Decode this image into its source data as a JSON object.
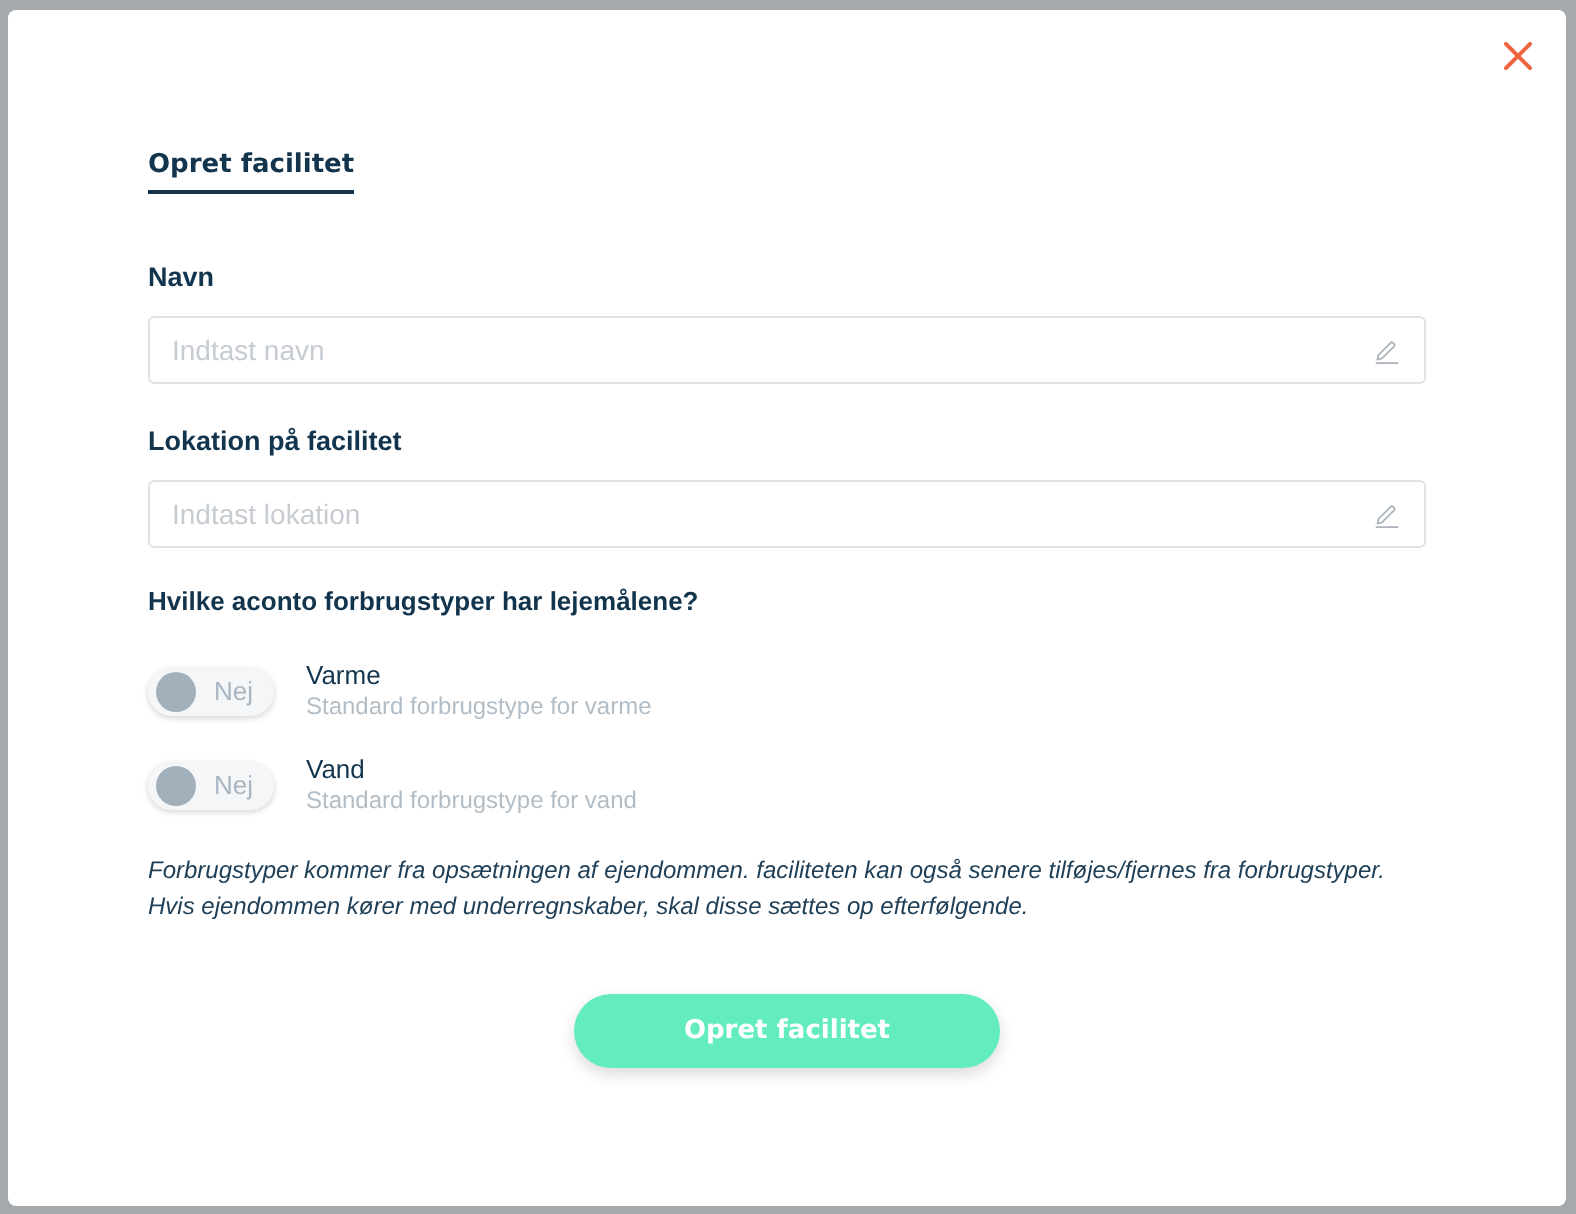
{
  "tabs": [
    {
      "label": "Opret facilitet",
      "selected": true
    }
  ],
  "fields": [
    {
      "label": "Navn",
      "placeholder": "Indtast navn"
    },
    {
      "label": "Lokation på facilitet",
      "placeholder": "Indtast lokation"
    }
  ],
  "question": "Hvilke aconto forbrugstyper har lejemålene?",
  "consumption_types": [
    {
      "name": "Varme",
      "description": "Standard forbrugstype for varme",
      "on": false,
      "state_label": "Nej"
    },
    {
      "name": "Vand",
      "description": "Standard forbrugstype for vand",
      "on": false,
      "state_label": "Nej"
    }
  ],
  "note_lines": [
    "Forbrugstyper kommer fra opsætningen af ejendommen. faciliteten kan også senere tilføjes/fjernes fra forbrugstyper.",
    "Hvis ejendommen kører med underregnskaber, skal disse sættes op efterfølgende."
  ],
  "submit_button": "Opret facilitet"
}
